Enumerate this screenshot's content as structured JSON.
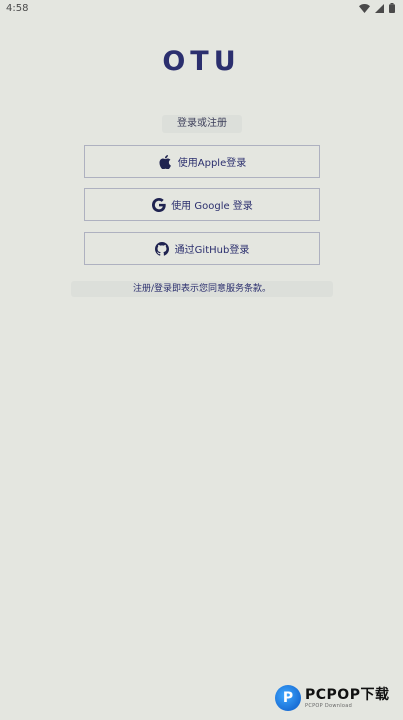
{
  "status_bar": {
    "time": "4:58"
  },
  "app": {
    "logo": "OTU"
  },
  "login": {
    "section_label": "登录或注册",
    "apple_label": "使用Apple登录",
    "google_label": "使用 Google 登录",
    "github_label": "通过GitHub登录"
  },
  "terms": {
    "text": "注册/登录即表示您同意服务条款。"
  },
  "watermark": {
    "brand": "PCPOP下载",
    "sub": "PCPOP Download",
    "logo_letter": "P"
  },
  "colors": {
    "background": "#e4e6e0",
    "accent": "#2b2f6e",
    "border": "#aeb1c0"
  },
  "icons": {
    "apple": "apple-icon",
    "google": "google-icon",
    "github": "github-icon",
    "wifi": "wifi-icon",
    "signal": "signal-icon",
    "battery": "battery-icon"
  }
}
